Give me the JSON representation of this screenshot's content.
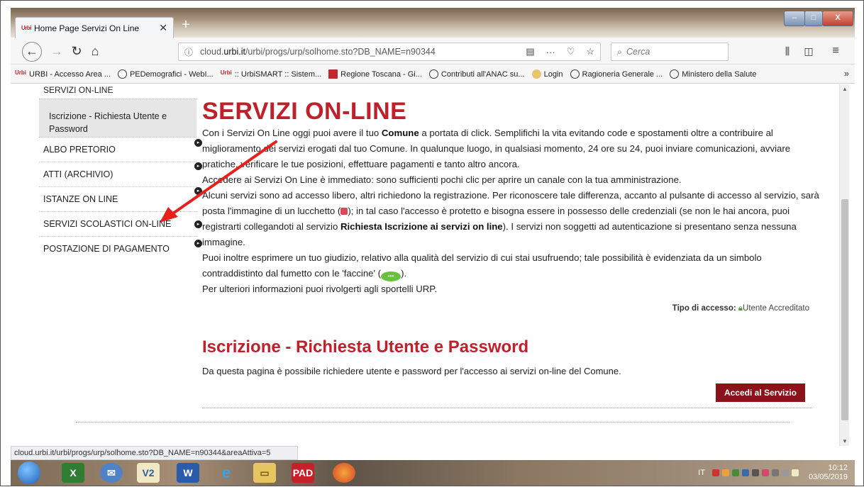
{
  "browser": {
    "tab_title": "Home Page Servizi On Line",
    "tab_logo": "urbi",
    "url_prefix": "cloud.",
    "url_domain": "urbi.it",
    "url_path": "/urbi/progs/urp/solhome.sto?DB_NAME=n90344",
    "search_placeholder": "Cerca",
    "status_url": "cloud.urbi.it/urbi/progs/urp/solhome.sto?DB_NAME=n90344&areaAttiva=5"
  },
  "bookmarks": [
    {
      "label": "URBI - Accesso Area ...",
      "icon": "urbi-icon"
    },
    {
      "label": "PEDemografici - WebI...",
      "icon": "globe-icon"
    },
    {
      "label": ":: UrbiSMART :: Sistem...",
      "icon": "urbi-icon"
    },
    {
      "label": "Regione Toscana - Gi...",
      "icon": "toscana-icon"
    },
    {
      "label": "Contributi all'ANAC su...",
      "icon": "globe-icon"
    },
    {
      "label": "Login",
      "icon": "login-icon"
    },
    {
      "label": "Ragioneria Generale ...",
      "icon": "globe-icon"
    },
    {
      "label": "Ministero della Salute",
      "icon": "globe-icon"
    }
  ],
  "sidebar": {
    "header": "SERVIZI ON-LINE",
    "active": "Iscrizione - Richiesta Utente e Password",
    "items": [
      {
        "label": "ALBO PRETORIO"
      },
      {
        "label": "ATTI (ARCHIVIO)"
      },
      {
        "label": "ISTANZE ON LINE"
      },
      {
        "label": "SERVIZI SCOLASTICI ON-LINE"
      },
      {
        "label": "POSTAZIONE DI PAGAMENTO"
      }
    ]
  },
  "main": {
    "title": "SERVIZI ON-LINE",
    "p1_a": "Con i Servizi On Line oggi puoi avere il tuo ",
    "p1_b": "Comune",
    "p1_c": " a portata di click. Semplifichi la vita evitando code e spostamenti oltre a contribuire al miglioramento dei servizi erogati dal tuo Comune. In qualunque luogo, in qualsiasi momento, 24 ore su 24, puoi inviare comunicazioni, avviare pratiche, verificare le tue posizioni, effettuare pagamenti e tanto altro ancora.",
    "p2": "Accedere ai Servizi On Line è immediato: sono sufficienti pochi clic per aprire un canale con la tua amministrazione.",
    "p3_a": "Alcuni servizi sono ad accesso libero, altri richiedono la registrazione. Per riconoscere tale differenza, accanto al pulsante di accesso al servizio, sarà posta l'immagine di un lucchetto (",
    "p3_b": "); in tal caso l'accesso è protetto e bisogna essere in possesso delle credenziali (se non le hai ancora, puoi registrarti collegandoti al servizio ",
    "p3_c": "Richiesta Iscrizione ai servizi on line",
    "p3_d": "). I servizi non soggetti ad autenticazione si presentano senza nessuna immagine.",
    "p4_a": "Puoi inoltre esprimere un tuo giudizio, relativo alla qualità del servizio di cui stai usufruendo; tale possibilità è evidenziata da un simbolo contraddistinto dal fumetto con le 'faccine' (",
    "p4_b": ").",
    "p5": "Per ulteriori informazioni puoi rivolgerti agli sportelli URP.",
    "access_label": "Tipo di accesso:",
    "access_value": "Utente Accreditato",
    "section_title": "Iscrizione - Richiesta Utente e Password",
    "section_desc": "Da questa pagina è possibile richiedere utente e password per l'accesso ai servizi on-line del Comune.",
    "button_label": "Accedi al Servizio"
  },
  "taskbar": {
    "apps": [
      "windows-start",
      "excel",
      "thunderbird",
      "v2",
      "word",
      "ie",
      "explorer",
      "pad",
      "firefox"
    ],
    "tray_lang": "IT",
    "time": "10:12",
    "date": "03/05/2019"
  },
  "colors": {
    "accent_red": "#c0202a",
    "button_dark_red": "#8b1219",
    "annotation_arrow": "#e8201c"
  }
}
